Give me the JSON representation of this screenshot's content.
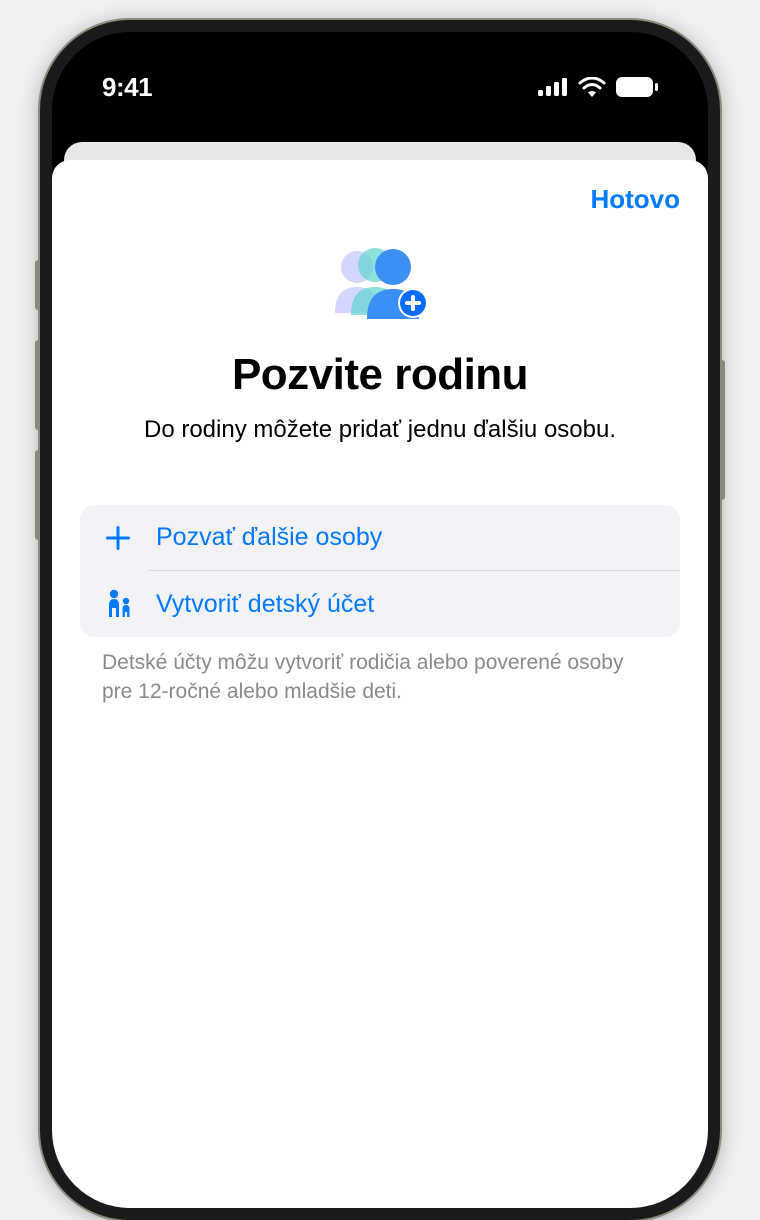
{
  "status_bar": {
    "time": "9:41"
  },
  "sheet": {
    "done_label": "Hotovo",
    "title": "Pozvite rodinu",
    "subtitle": "Do rodiny môžete pridať jednu ďalšiu osobu.",
    "actions": {
      "invite_label": "Pozvať ďalšie osoby",
      "create_child_label": "Vytvoriť detský účet"
    },
    "footer": "Detské účty môžu vytvoriť rodičia alebo poverené osoby pre 12-ročné alebo mladšie deti."
  },
  "colors": {
    "accent": "#007aff",
    "secondary_bg": "#f2f2f7",
    "muted_text": "#8a8a8e"
  }
}
